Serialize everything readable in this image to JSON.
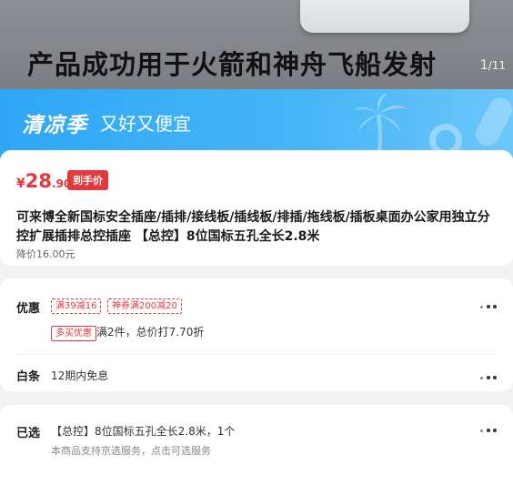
{
  "hero": {
    "title": "产品成功用于火箭和神舟飞船发射",
    "page_current": "1",
    "page_total": "/11"
  },
  "promo": {
    "logo": "清凉季",
    "slogan": "又好又便宜"
  },
  "product": {
    "currency": "¥",
    "price_int": "28",
    "price_dec": ".90",
    "price_tag": "到手价",
    "title": "可来博全新国标安全插座/插排/接线板/插线板/排插/拖线板/插板桌面办公家用独立分控扩展插排总控插座 【总控】8位国标五孔全长2.8米",
    "original_price": "降价16.00元"
  },
  "offers": {
    "label": "优惠",
    "coupons": [
      "满39减16",
      "神券满200减20"
    ],
    "multi_badge": "多买优惠",
    "multi_text": "满2件，总价打7.70折",
    "baitiao_label": "白条",
    "baitiao_text": "12期内免息"
  },
  "selected": {
    "label": "已选",
    "value": "【总控】8位国标五孔全长2.8米，1个",
    "sub": "本商品支持京选服务，点击可选服务"
  },
  "colors": {
    "price_red": "#e4393c",
    "promo_blue": "#2fa7f5"
  }
}
